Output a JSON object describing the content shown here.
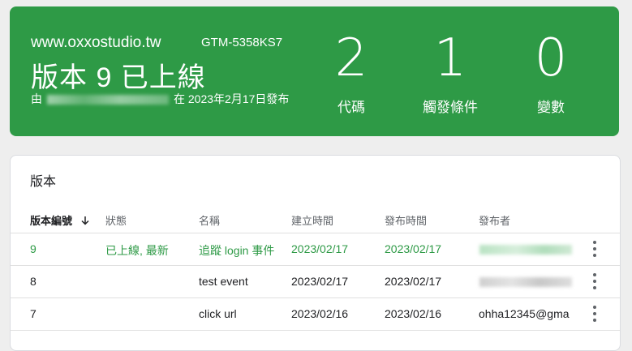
{
  "header": {
    "site": "www.oxxostudio.tw",
    "container_id": "GTM-5358KS7",
    "version_title": "版本 9 已上線",
    "published_prefix": "由",
    "published_suffix": "在 2023年2月17日發布",
    "stats": [
      {
        "value": "2",
        "label": "代碼"
      },
      {
        "value": "1",
        "label": "觸發條件"
      },
      {
        "value": "0",
        "label": "變數"
      }
    ]
  },
  "versions": {
    "title": "版本",
    "columns": [
      "版本編號",
      "狀態",
      "名稱",
      "建立時間",
      "發布時間",
      "發布者"
    ],
    "sort_icon": "arrow-down-icon",
    "rows": [
      {
        "id": "9",
        "status": "已上線, 最新",
        "name": "追蹤 login 事件",
        "created": "2023/02/17",
        "published": "2023/02/17",
        "publisher": ""
      },
      {
        "id": "8",
        "status": "",
        "name": "test event",
        "created": "2023/02/17",
        "published": "2023/02/17",
        "publisher": ""
      },
      {
        "id": "7",
        "status": "",
        "name": "click url",
        "created": "2023/02/16",
        "published": "2023/02/16",
        "publisher": "ohha12345@gma"
      }
    ]
  },
  "colors": {
    "brand_green": "#2e9a46",
    "text": "#202124",
    "muted": "#5f6368"
  }
}
